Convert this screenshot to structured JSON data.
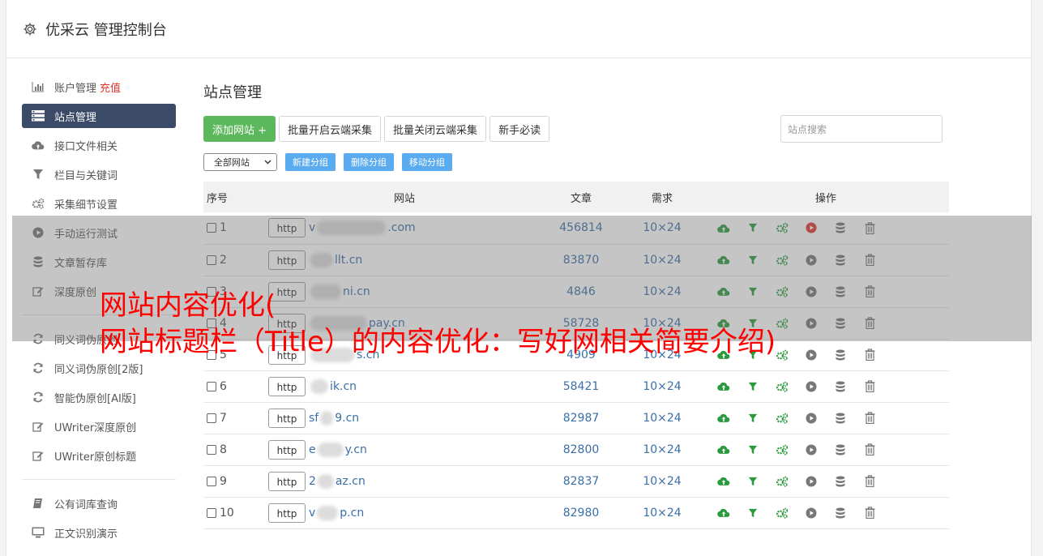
{
  "app": {
    "title": "优采云 管理控制台",
    "icon": "gear-icon"
  },
  "sidebar": {
    "items": [
      {
        "label": "账户管理",
        "extra": "充值",
        "icon": "bar-chart-icon",
        "active": false
      },
      {
        "label": "站点管理",
        "icon": "server-list-icon",
        "active": true
      },
      {
        "label": "接口文件相关",
        "icon": "cloud-upload-icon",
        "active": false
      },
      {
        "label": "栏目与关键词",
        "icon": "filter-icon",
        "active": false
      },
      {
        "label": "采集细节设置",
        "icon": "cogs-icon",
        "active": false
      },
      {
        "label": "手动运行测试",
        "icon": "play-circle-icon",
        "active": false
      },
      {
        "label": "文章暂存库",
        "icon": "database-icon",
        "active": false
      },
      {
        "label": "深度原创",
        "icon": "edit-icon",
        "active": false
      }
    ],
    "items2": [
      {
        "label": "同义词伪原创",
        "icon": "refresh-icon"
      },
      {
        "label": "同义词伪原创[2版]",
        "icon": "refresh-icon"
      },
      {
        "label": "智能伪原创[AI版]",
        "icon": "refresh-icon"
      },
      {
        "label": "UWriter深度原创",
        "icon": "edit-icon"
      },
      {
        "label": "UWriter原创标题",
        "icon": "edit-icon"
      }
    ],
    "items3": [
      {
        "label": "公有词库查询",
        "icon": "book-icon"
      },
      {
        "label": "正文识别演示",
        "icon": "monitor-icon"
      }
    ]
  },
  "main": {
    "title": "站点管理",
    "buttons": {
      "add": "添加网站 +",
      "batch_open": "批量开启云端采集",
      "batch_close": "批量关闭云端采集",
      "guide": "新手必读"
    },
    "search_placeholder": "站点搜索",
    "group_select": "全部网站",
    "group_buttons": {
      "new": "新建分组",
      "delete": "删除分组",
      "move": "移动分组"
    },
    "table": {
      "headers": {
        "num": "序号",
        "site": "网站",
        "articles": "文章",
        "demand": "需求",
        "ops": "操作"
      },
      "rows": [
        {
          "num": "1",
          "http": "http",
          "pre": "v",
          "post": ".com",
          "articles": "456814",
          "demand": "10×24",
          "active": true
        },
        {
          "num": "2",
          "http": "http",
          "pre": "",
          "post": "llt.cn",
          "articles": "83870",
          "demand": "10×24",
          "active": false
        },
        {
          "num": "3",
          "http": "http",
          "pre": "",
          "post": "ni.cn",
          "articles": "4846",
          "demand": "10×24",
          "active": false
        },
        {
          "num": "4",
          "http": "http",
          "pre": "",
          "post": "pay.cn",
          "articles": "58728",
          "demand": "10×24",
          "active": false
        },
        {
          "num": "5",
          "http": "http",
          "pre": "",
          "post": "s.cn",
          "articles": "4909",
          "demand": "10×24",
          "active": false
        },
        {
          "num": "6",
          "http": "http",
          "pre": "",
          "post": "ik.cn",
          "articles": "58421",
          "demand": "10×24",
          "active": false
        },
        {
          "num": "7",
          "http": "http",
          "pre": "sf",
          "post": "9.cn",
          "articles": "82987",
          "demand": "10×24",
          "active": false
        },
        {
          "num": "8",
          "http": "http",
          "pre": "e",
          "post": "y.cn",
          "articles": "82800",
          "demand": "10×24",
          "active": false
        },
        {
          "num": "9",
          "http": "http",
          "pre": "2",
          "post": "az.cn",
          "articles": "82837",
          "demand": "10×24",
          "active": false
        },
        {
          "num": "10",
          "http": "http",
          "pre": "v",
          "post": "p.cn",
          "articles": "82980",
          "demand": "10×24",
          "active": false
        }
      ]
    }
  },
  "overlay": {
    "line1": "网站内容优化(",
    "line2": "网站标题栏（Title）的内容优化：写好网相关简要介绍)"
  },
  "colors": {
    "accent_green": "#5cb85c",
    "sidebar_active": "#3b4a66",
    "link_blue": "#3a6fa8",
    "overlay_text": "#ff0000",
    "run_red": "#e0342b"
  }
}
